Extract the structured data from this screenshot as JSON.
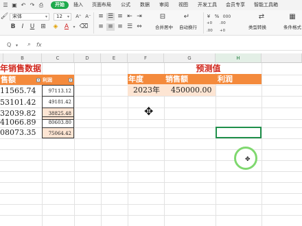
{
  "tabs": [
    "开始",
    "插入",
    "页面布局",
    "公式",
    "数据",
    "审阅",
    "视图",
    "开发工具",
    "会员专享",
    "智能工具箱"
  ],
  "toolbar": {
    "font_name": "宋体",
    "font_size": "12",
    "merge_center": "合并居中",
    "wrap_text": "自动换行",
    "cell_type": "类型转换",
    "cond_format": "条件格式",
    "percent_symbol": "%",
    "thousands_sep": "000",
    "increase_decimal": "+0 .00",
    "decrease_decimal": ".00 +0",
    "font_color_letter": "A",
    "bold": "B",
    "italic": "I",
    "underline": "U",
    "font_grow": "A⁺",
    "font_shrink": "A⁻"
  },
  "formula_bar": {
    "cell_ref": "Q",
    "fx": "fx"
  },
  "columns": [
    "B",
    "C",
    "D",
    "E",
    "F",
    "G",
    "H"
  ],
  "selected_column": "H",
  "rows_left": {
    "title": "年销售数据",
    "header_b": "售额",
    "header_c": "利润",
    "values_b": [
      "11565.74",
      "53101.42",
      "32039.82",
      "41066.89",
      "08073.35"
    ],
    "values_c": [
      "97113.12",
      "49181.42",
      "38825.48",
      "80603.80",
      "75064.42"
    ]
  },
  "forecast": {
    "title": "预测值",
    "header_year": "年度",
    "header_sales": "销售额",
    "header_profit": "利润",
    "year": "2023年",
    "sales": "450000.00"
  },
  "colors": {
    "accent_green": "#1eaa4c",
    "header_orange": "#f48a3c",
    "title_red": "#d1281e",
    "peach_fill": "#fde5d3",
    "selection_green": "#1e8f4a"
  }
}
